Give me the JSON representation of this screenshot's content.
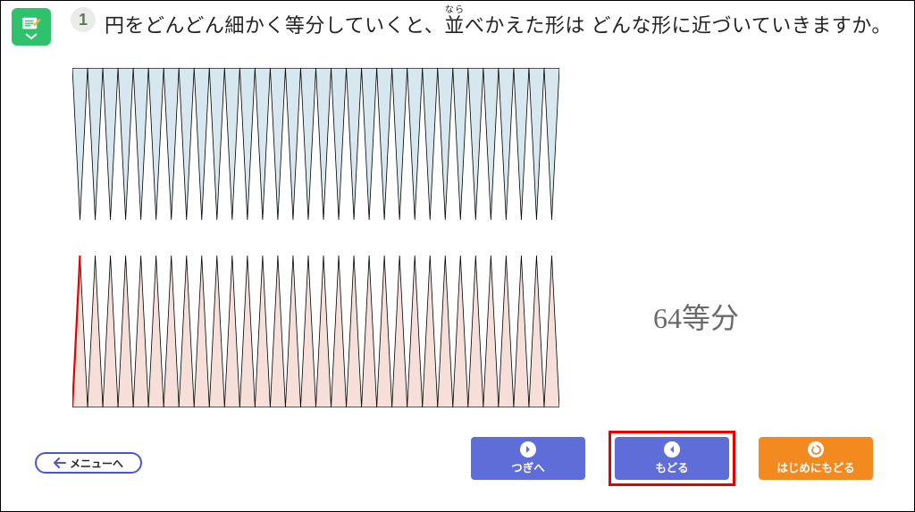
{
  "question": {
    "number": "1",
    "text_part1": "円をどんどん細かく等分していくと、",
    "ruby_base": "並",
    "ruby_top": "なら",
    "text_part2": "べかえた形は どんな形に近づいていきますか。"
  },
  "division": {
    "value": "64",
    "suffix": "等分"
  },
  "diagram": {
    "segments": 32,
    "top_fill": "#d7e7f0",
    "bottom_fill": "#f6dfd9",
    "stroke": "#000000",
    "highlight_stroke": "#e60000"
  },
  "buttons": {
    "menu": "メニューへ",
    "next": "つぎへ",
    "back": "もどる",
    "restart": "はじめにもどる"
  },
  "colors": {
    "green": "#2fc16b",
    "blue": "#5e6dd8",
    "orange": "#f28a1f",
    "outline_blue": "#4a56c9",
    "red": "#e60000"
  }
}
